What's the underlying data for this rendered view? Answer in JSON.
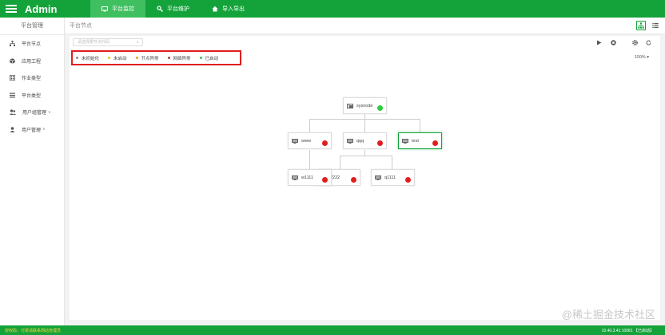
{
  "app": {
    "title": "Admin"
  },
  "nav": {
    "tabs": [
      {
        "label": "平台监控",
        "active": true
      },
      {
        "label": "平台维护",
        "active": false
      },
      {
        "label": "导入导出",
        "active": false
      }
    ]
  },
  "sidebar": {
    "heading": "平台管理",
    "items": [
      {
        "label": "平台节点",
        "icon": "tree-icon"
      },
      {
        "label": "应用工程",
        "icon": "cube-icon"
      },
      {
        "label": "作业类型",
        "icon": "grid-icon"
      },
      {
        "label": "平台类型",
        "icon": "list-icon"
      },
      {
        "label": "用户组管理",
        "icon": "users-icon",
        "caret": "∨"
      },
      {
        "label": "用户管理",
        "icon": "user-icon",
        "caret": "∨"
      }
    ]
  },
  "content": {
    "title": "平台节点",
    "select_placeholder": "请选择根节点代码",
    "zoom": "100%",
    "zoom_caret": "▾"
  },
  "legend": [
    {
      "label": "未初始化",
      "color": "#888888"
    },
    {
      "label": "未启动",
      "color": "#f0c419"
    },
    {
      "label": "节点异常",
      "color": "#f39c12"
    },
    {
      "label": "网络异常",
      "color": "#c0392b"
    },
    {
      "label": "已启动",
      "color": "#2ecc40"
    }
  ],
  "nodes": {
    "root": {
      "label": "sysnode",
      "status_color": "#2ecc40"
    },
    "www": {
      "label": "www",
      "status_color": "#e01e1e"
    },
    "qqq": {
      "label": "qqq",
      "status_color": "#e01e1e"
    },
    "test": {
      "label": "test",
      "status_color": "#e01e1e"
    },
    "w1111": {
      "label": "w1111",
      "status_color": "#e01e1e"
    },
    "n2222": {
      "label": "2222",
      "status_color": "#e01e1e"
    },
    "q1111": {
      "label": "q1111",
      "status_color": "#e01e1e"
    }
  },
  "footer": {
    "left": "授权码：付费请联系网站管理员",
    "right": "10.40.3.41:10081 【已启动】"
  },
  "watermark": "@稀土掘金技术社区",
  "colors": {
    "brand": "#14a33a",
    "brand_light": "#3fbf5f",
    "highlight": "#e01e1e"
  }
}
